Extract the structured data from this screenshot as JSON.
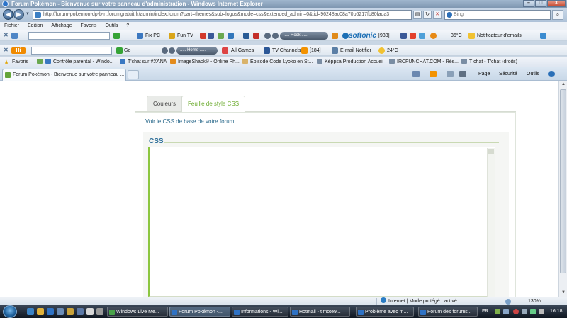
{
  "window": {
    "title": "Forum Pokémon - Bienvenue sur votre panneau d'administration - Windows Internet Explorer",
    "minimize": "–",
    "maximize": "□",
    "close": "X"
  },
  "address": {
    "url": "http://forum-pokemon-dp-b-n.forumgratuit.fr/admin/index.forum?part=themes&sub=logos&mode=css&extended_admin=0&tid=96248ac08a70b6217fb80fada3",
    "search_placeholder": "Bing",
    "refresh": "↻",
    "stop": "✕"
  },
  "menu": [
    "Fichier",
    "Edition",
    "Affichage",
    "Favoris",
    "Outils",
    "?"
  ],
  "toolbar1": {
    "fix_pc": "Fix PC",
    "fun_tv": "Fun TV",
    "rock": "..... Rock .....",
    "softonic": "softonic",
    "softonic_count": "[933]",
    "temp": "36°C",
    "notifier": "Notificateur d'emails"
  },
  "toolbar2": {
    "go": "Go",
    "home": "..... Home .....",
    "all_games": "All Games",
    "tv_channels": "TV Channels",
    "rss_count": "[184]",
    "email_notifier": "E-mail Notifier",
    "temp": "24°C"
  },
  "favorites_bar": {
    "favoris": "Favoris",
    "items": [
      "Contrôle parental - Windo...",
      "T'chat sur #XANA",
      "ImageShack® - Online Ph...",
      "Episode Code Lyoko en St...",
      "Képpsa Production Accueil",
      "IRCFUNCHAT.COM - Rés...",
      "T chat - T'chat (droits)"
    ]
  },
  "ie_tabs": {
    "current": "Forum Pokémon - Bienvenue sur votre panneau ..."
  },
  "command_bar": {
    "page": "Page",
    "securite": "Sécurité",
    "outils": "Outils"
  },
  "content": {
    "tab_colors": "Couleurs",
    "tab_css": "Feuille de style CSS",
    "base_css_link": "Voir le CSS de base de votre forum",
    "css_legend": "CSS",
    "css_text": ""
  },
  "status": {
    "zone": "Internet | Mode protégé : activé",
    "zoom": "130%"
  },
  "taskbar": {
    "tasks": [
      "Windows Live Me...",
      "Forum Pokémon -...",
      "Informations - Wi...",
      "Hotmail - timote9...",
      "Problème avec m...",
      "Forum des forums..."
    ],
    "lang": "FR",
    "clock": "16:18"
  },
  "colors": {
    "accent_green": "#8cc640",
    "tab_active_text": "#6aaa2b",
    "link_blue": "#2b6a8c",
    "legend_blue": "#2e6f99"
  }
}
